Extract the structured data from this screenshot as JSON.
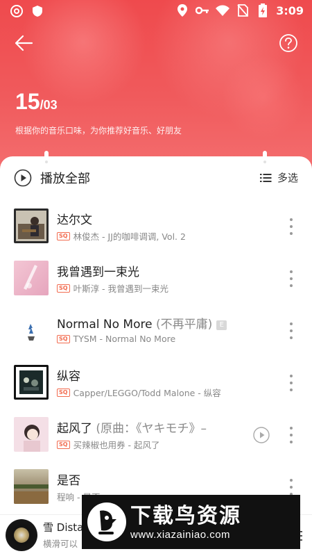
{
  "status_bar": {
    "time": "3:09",
    "icons": [
      "netease-icon",
      "shield-icon",
      "location-icon",
      "key-icon",
      "wifi-icon",
      "no-sim-icon",
      "battery-charging-icon"
    ]
  },
  "header": {
    "day": "15",
    "month": "03",
    "separator": "/",
    "subtitle": "根据你的音乐口味，为你推荐好音乐、好朋友",
    "back_icon": "arrow-left-icon",
    "help_icon": "question-circle-icon"
  },
  "toolbar": {
    "play_all_label": "播放全部",
    "multi_select_label": "多选"
  },
  "songs": [
    {
      "title": "达尔文",
      "alias": "",
      "explicit": false,
      "quality": "SQ",
      "subtitle": "林俊杰 - JJ的咖啡调调, Vol. 2",
      "has_mv": false
    },
    {
      "title": "我曾遇到一束光",
      "alias": "",
      "explicit": false,
      "quality": "SQ",
      "subtitle": "叶斯淳 - 我曾遇到一束光",
      "has_mv": false
    },
    {
      "title": "Normal No More ",
      "alias": "(不再平庸)",
      "explicit": true,
      "explicit_label": "E",
      "quality": "SQ",
      "subtitle": "TYSM - Normal No More",
      "has_mv": false
    },
    {
      "title": "纵容",
      "alias": "",
      "explicit": false,
      "quality": "SQ",
      "subtitle": "Capper/LEGGO/Todd Malone - 纵容",
      "has_mv": false
    },
    {
      "title": "起风了 ",
      "alias": "(原曲：《ヤキモチ》–",
      "explicit": false,
      "quality": "SQ",
      "subtitle": "买辣椒也用券 - 起风了",
      "has_mv": true
    },
    {
      "title": "是否",
      "alias": "",
      "explicit": false,
      "quality": "",
      "subtitle": "程响 - 是否",
      "has_mv": false
    }
  ],
  "player": {
    "title": "雪 Dista",
    "hint": "横滑可以"
  },
  "watermark": {
    "title": "下载鸟资源",
    "url": "www.xiazainiao.com"
  },
  "colors": {
    "header_red": "#ef4a4d",
    "sq_orange": "#f26b4f"
  }
}
